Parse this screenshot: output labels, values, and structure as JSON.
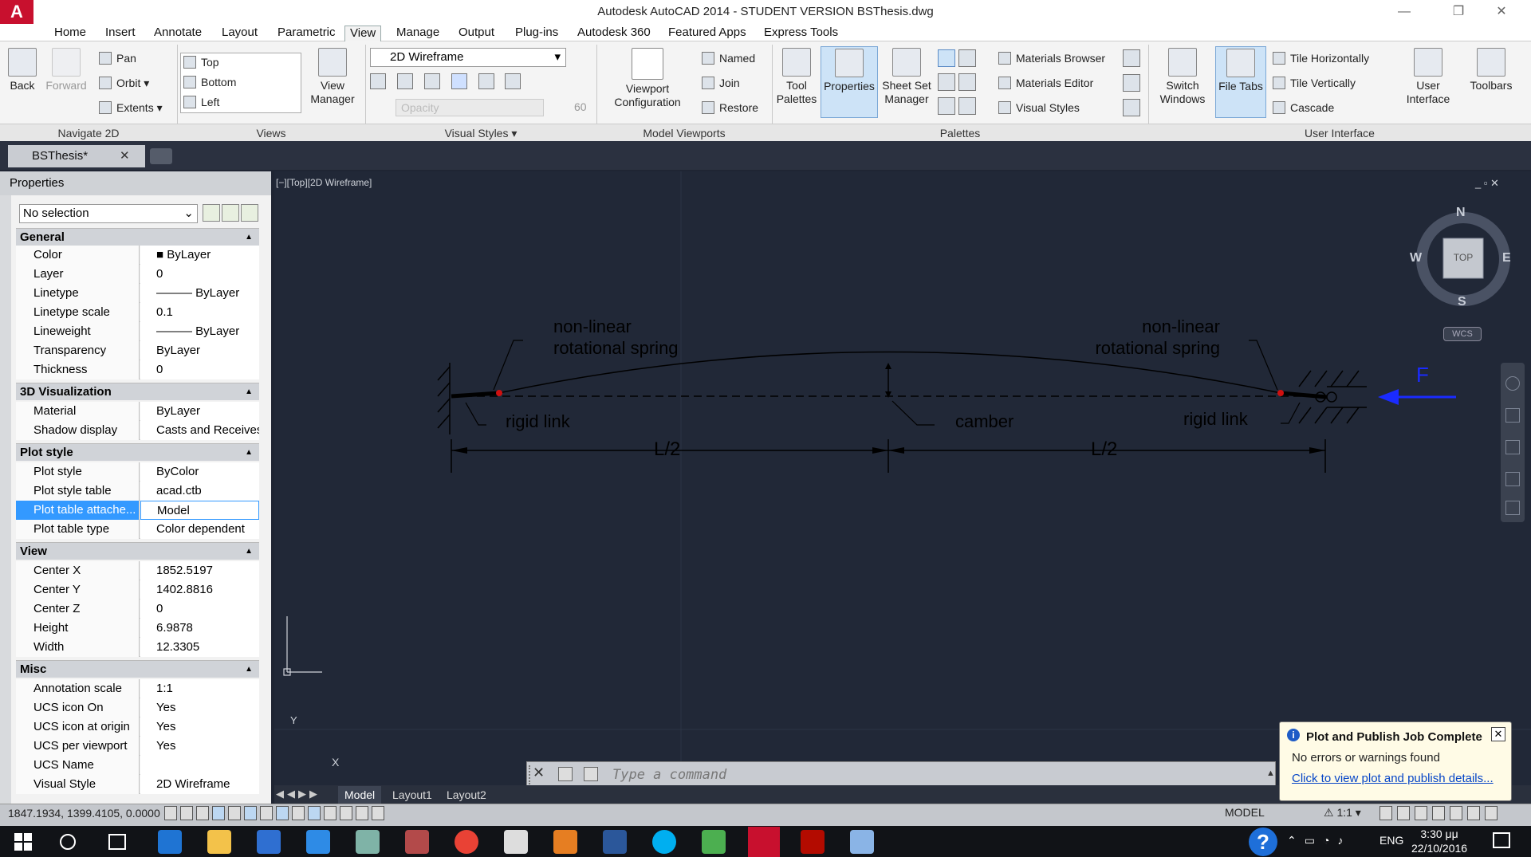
{
  "window": {
    "logo": "A",
    "title": "Autodesk AutoCAD 2014 - STUDENT VERSION    BSThesis.dwg",
    "minimize": "—",
    "restore": "❐",
    "close": "✕"
  },
  "menu": [
    {
      "label": "Home"
    },
    {
      "label": "Insert"
    },
    {
      "label": "Annotate"
    },
    {
      "label": "Layout"
    },
    {
      "label": "Parametric"
    },
    {
      "label": "View"
    },
    {
      "label": "Manage"
    },
    {
      "label": "Output"
    },
    {
      "label": "Plug-ins"
    },
    {
      "label": "Autodesk 360"
    },
    {
      "label": "Featured Apps"
    },
    {
      "label": "Express Tools"
    }
  ],
  "active_menu": "View",
  "ribbon": {
    "navigate": {
      "back": "Back",
      "forward": "Forward",
      "pan": "Pan",
      "orbit": "Orbit",
      "extents": "Extents",
      "panel": "Navigate 2D"
    },
    "views": {
      "items": [
        "Top",
        "Bottom",
        "Left"
      ],
      "view_manager_1": "View",
      "view_manager_2": "Manager",
      "panel": "Views"
    },
    "visual_styles": {
      "current": "2D Wireframe",
      "opacity_label": "Opacity",
      "opacity_value": "60",
      "panel": "Visual Styles"
    },
    "model_viewports": {
      "viewport_config_1": "Viewport",
      "viewport_config_2": "Configuration",
      "named": "Named",
      "join": "Join",
      "restore": "Restore",
      "panel": "Model Viewports"
    },
    "palettes": {
      "tool_palettes_1": "Tool",
      "tool_palettes_2": "Palettes",
      "properties": "Properties",
      "sheet_set_1": "Sheet Set",
      "sheet_set_2": "Manager",
      "materials_browser": "Materials Browser",
      "materials_editor": "Materials Editor",
      "visual_styles": "Visual Styles",
      "panel": "Palettes"
    },
    "user_interface": {
      "switch_windows_1": "Switch",
      "switch_windows_2": "Windows",
      "file_tabs": "File Tabs",
      "tile_h": "Tile Horizontally",
      "tile_v": "Tile Vertically",
      "cascade": "Cascade",
      "user_interface_1": "User",
      "user_interface_2": "Interface",
      "toolbars": "Toolbars",
      "panel": "User Interface"
    }
  },
  "doc_tab": {
    "name": "BSThesis*",
    "close": "✕"
  },
  "properties": {
    "title": "Properties",
    "selection": "No selection",
    "sections": {
      "general": {
        "title": "General",
        "rows": [
          {
            "k": "Color",
            "v": "■ ByLayer"
          },
          {
            "k": "Layer",
            "v": "0"
          },
          {
            "k": "Linetype",
            "v": "——— ByLayer"
          },
          {
            "k": "Linetype scale",
            "v": "0.1"
          },
          {
            "k": "Lineweight",
            "v": "——— ByLayer"
          },
          {
            "k": "Transparency",
            "v": "ByLayer"
          },
          {
            "k": "Thickness",
            "v": "0"
          }
        ]
      },
      "viz3d": {
        "title": "3D Visualization",
        "rows": [
          {
            "k": "Material",
            "v": "ByLayer"
          },
          {
            "k": "Shadow display",
            "v": "Casts and Receives S..."
          }
        ]
      },
      "plot": {
        "title": "Plot style",
        "rows": [
          {
            "k": "Plot style",
            "v": "ByColor"
          },
          {
            "k": "Plot style table",
            "v": "acad.ctb"
          },
          {
            "k": "Plot table attache...",
            "v": "Model"
          },
          {
            "k": "Plot table type",
            "v": "Color dependent"
          }
        ]
      },
      "view": {
        "title": "View",
        "rows": [
          {
            "k": "Center X",
            "v": "1852.5197"
          },
          {
            "k": "Center Y",
            "v": "1402.8816"
          },
          {
            "k": "Center Z",
            "v": "0"
          },
          {
            "k": "Height",
            "v": "6.9878"
          },
          {
            "k": "Width",
            "v": "12.3305"
          }
        ]
      },
      "misc": {
        "title": "Misc",
        "rows": [
          {
            "k": "Annotation scale",
            "v": "1:1"
          },
          {
            "k": "UCS icon On",
            "v": "Yes"
          },
          {
            "k": "UCS icon at origin",
            "v": "Yes"
          },
          {
            "k": "UCS per viewport",
            "v": "Yes"
          },
          {
            "k": "UCS Name",
            "v": ""
          },
          {
            "k": "Visual Style",
            "v": "2D Wireframe"
          }
        ]
      }
    }
  },
  "viewport": {
    "label": "[−][Top][2D Wireframe]",
    "controls": "_  ▫  ✕",
    "cube": {
      "n": "N",
      "s": "S",
      "e": "E",
      "w": "W",
      "face": "TOP",
      "wcs": "WCS"
    },
    "ucs_y": "Y",
    "ucs_x": "X"
  },
  "drawing": {
    "left_spring_1": "non-linear",
    "left_spring_2": "rotational spring",
    "right_spring_1": "non-linear",
    "right_spring_2": "rotational spring",
    "left_link": "rigid link",
    "right_link": "rigid link",
    "camber": "camber",
    "half_left": "L/2",
    "half_right": "L/2",
    "force": "F",
    "line_color": "#000000",
    "force_color": "#1a2bff",
    "spring_color": "#d01010"
  },
  "layout_tabs": [
    {
      "label": "Model"
    },
    {
      "label": "Layout1"
    },
    {
      "label": "Layout2"
    }
  ],
  "command": {
    "placeholder": "Type a command",
    "close": "✕"
  },
  "status": {
    "coords": "1847.1934, 1399.4105, 0.0000",
    "model": "MODEL",
    "scale": "1:1"
  },
  "balloon": {
    "title": "Plot and Publish Job Complete",
    "message": "No errors or warnings found",
    "link": "Click to view plot and publish details...",
    "close": "✕",
    "info": "i"
  },
  "taskbar": {
    "lang": "ENG",
    "time": "3:30 μμ",
    "date": "22/10/2016",
    "help": "?"
  }
}
